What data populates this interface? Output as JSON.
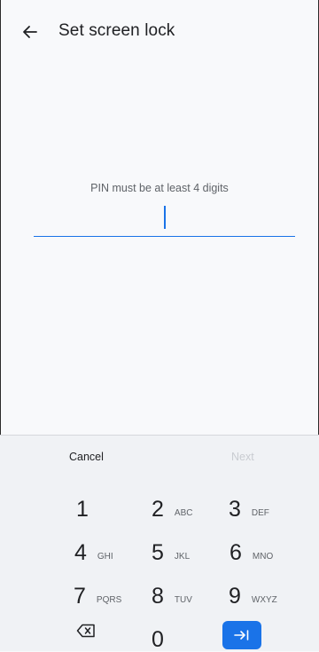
{
  "header": {
    "back_icon": "arrow-left-icon",
    "title": "Set screen lock"
  },
  "pin": {
    "hint": "PIN must be at least 4 digits",
    "value": ""
  },
  "keyboard": {
    "cancel_label": "Cancel",
    "next_label": "Next",
    "keys": [
      {
        "digit": "1",
        "letters": ""
      },
      {
        "digit": "2",
        "letters": "ABC"
      },
      {
        "digit": "3",
        "letters": "DEF"
      },
      {
        "digit": "4",
        "letters": "GHI"
      },
      {
        "digit": "5",
        "letters": "JKL"
      },
      {
        "digit": "6",
        "letters": "MNO"
      },
      {
        "digit": "7",
        "letters": "PQRS"
      },
      {
        "digit": "8",
        "letters": "TUV"
      },
      {
        "digit": "9",
        "letters": "WXYZ"
      },
      {
        "digit": "0",
        "letters": ""
      }
    ],
    "backspace_icon": "backspace-icon",
    "enter_icon": "tab-enter-icon",
    "accent": "#1a73e8"
  }
}
